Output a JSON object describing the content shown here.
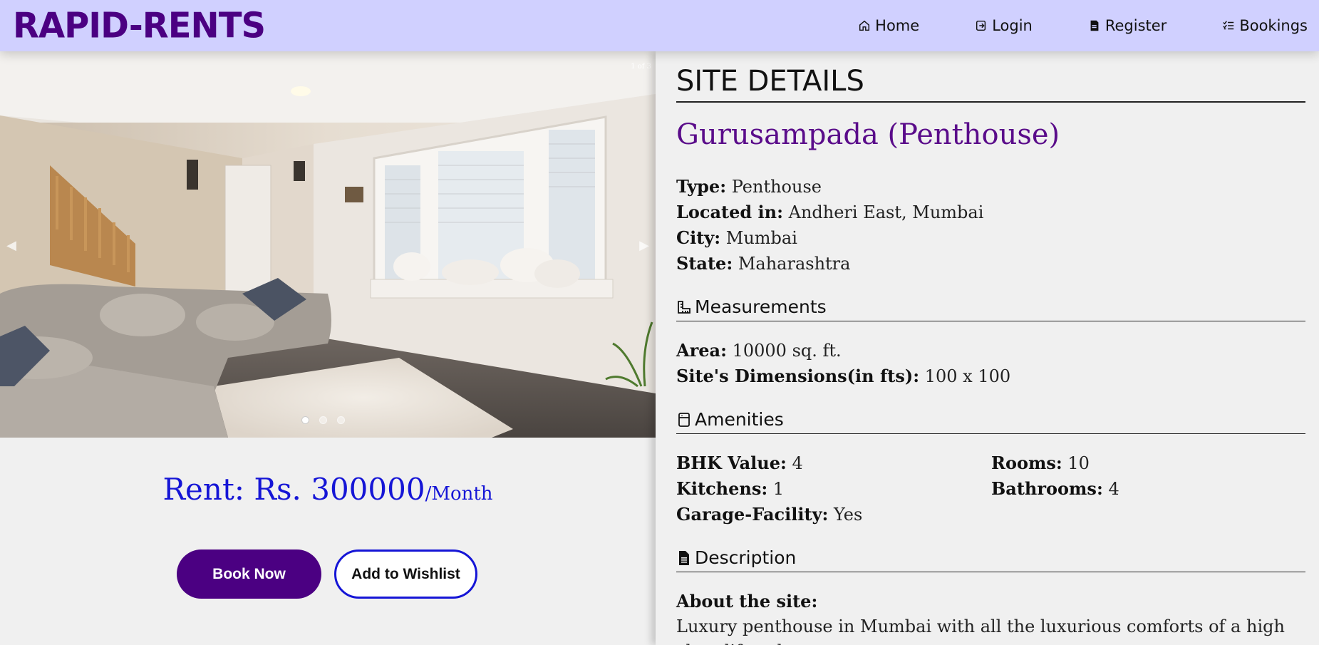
{
  "brand": {
    "name": "Rapid-Rents"
  },
  "nav": {
    "home": "Home",
    "login": "Login",
    "register": "Register",
    "bookings": "Bookings"
  },
  "carousel": {
    "counter": "1 of 3",
    "slides": 3,
    "active_slide": 1
  },
  "rent": {
    "amount": "Rent: Rs. 300000",
    "period": "/Month"
  },
  "buttons": {
    "book": "Book Now",
    "wishlist": "Add to Wishlist"
  },
  "details": {
    "section_title": "SITE DETAILS",
    "site_name": "Gurusampada (Penthouse)",
    "type_label": "Type:",
    "type": "Penthouse",
    "located_label": "Located in:",
    "located": "Andheri East, Mumbai",
    "city_label": "City:",
    "city": "Mumbai",
    "state_label": "State:",
    "state": "Maharashtra"
  },
  "measurements": {
    "heading": "Measurements",
    "area_label": "Area:",
    "area": "10000 sq. ft.",
    "dims_label": "Site's Dimensions(in fts):",
    "dims": "100 x 100"
  },
  "amenities": {
    "heading": "Amenities",
    "bhk_label": "BHK Value:",
    "bhk": "4",
    "rooms_label": "Rooms:",
    "rooms": "10",
    "kitchens_label": "Kitchens:",
    "kitchens": "1",
    "bathrooms_label": "Bathrooms:",
    "bathrooms": "4",
    "garage_label": "Garage-Facility:",
    "garage": "Yes"
  },
  "description": {
    "heading": "Description",
    "about_label": "About the site:",
    "text": "Luxury penthouse in Mumbai with all the luxurious comforts of a high class lifestyle."
  },
  "colors": {
    "navbar_bg": "#d0d0ff",
    "brand": "#4b0082",
    "rent": "#1515d6",
    "site_name": "#5a0c8a",
    "book_button": "#4b0082"
  },
  "icons": {
    "home": "home-icon",
    "login": "login-icon",
    "register": "register-icon",
    "bookings": "list-icon",
    "measurements": "ruler-icon",
    "amenities": "appliance-icon",
    "description": "document-icon"
  }
}
